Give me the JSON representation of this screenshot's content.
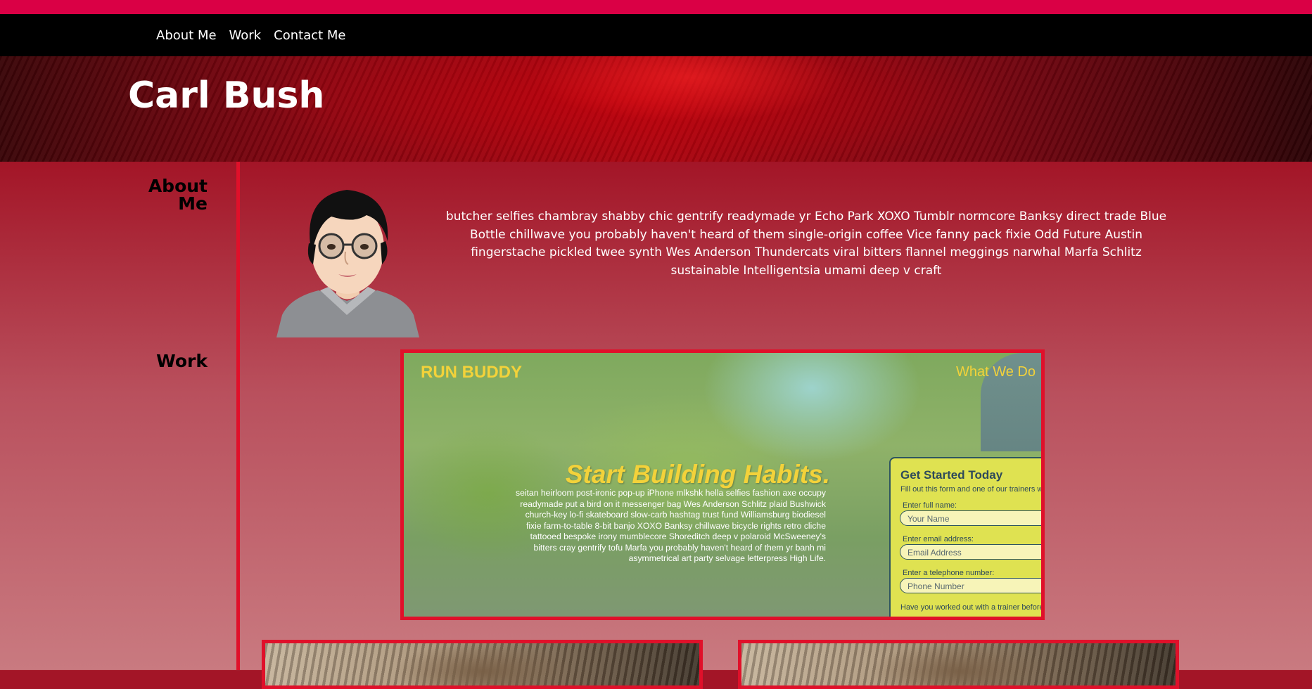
{
  "nav": {
    "items": [
      {
        "label": "About Me"
      },
      {
        "label": "Work"
      },
      {
        "label": "Contact Me"
      }
    ]
  },
  "header": {
    "title": "Carl Bush"
  },
  "sections": {
    "about": {
      "label": "About Me",
      "text": "butcher selfies chambray shabby chic gentrify readymade yr Echo Park XOXO Tumblr normcore Banksy direct trade Blue Bottle chillwave you probably haven't heard of them single-origin coffee Vice fanny pack fixie Odd Future Austin fingerstache pickled twee synth Wes Anderson Thundercats viral bitters flannel meggings narwhal Marfa Schlitz sustainable Intelligentsia umami deep v craft"
    },
    "work": {
      "label": "Work",
      "project": {
        "logo": "RUN BUDDY",
        "nav_item": "What We Do",
        "headline": "Start Building Habits.",
        "body": "seitan heirloom post-ironic pop-up iPhone mlkshk hella selfies fashion axe occupy readymade put a bird on it messenger bag Wes Anderson Schlitz plaid Bushwick church-key lo-fi skateboard slow-carb hashtag trust fund Williamsburg biodiesel fixie farm-to-table 8-bit banjo XOXO Banksy chillwave bicycle rights retro cliche tattooed bespoke irony mumblecore Shoreditch deep v polaroid McSweeney's bitters cray gentrify tofu Marfa you probably haven't heard of them yr banh mi asymmetrical art party selvage letterpress High Life.",
        "form": {
          "title": "Get Started Today",
          "subtitle": "Fill out this form and one of our trainers will",
          "name_label": "Enter full name:",
          "name_placeholder": "Your Name",
          "email_label": "Enter email address:",
          "email_placeholder": "Email Address",
          "phone_label": "Enter a telephone number:",
          "phone_placeholder": "Phone Number",
          "question": "Have you worked out with a trainer before?"
        }
      }
    }
  },
  "colors": {
    "top_bar": "#da0045",
    "nav_bg": "#000000",
    "accent_border": "#e0102a",
    "header_text": "#ffffff"
  }
}
